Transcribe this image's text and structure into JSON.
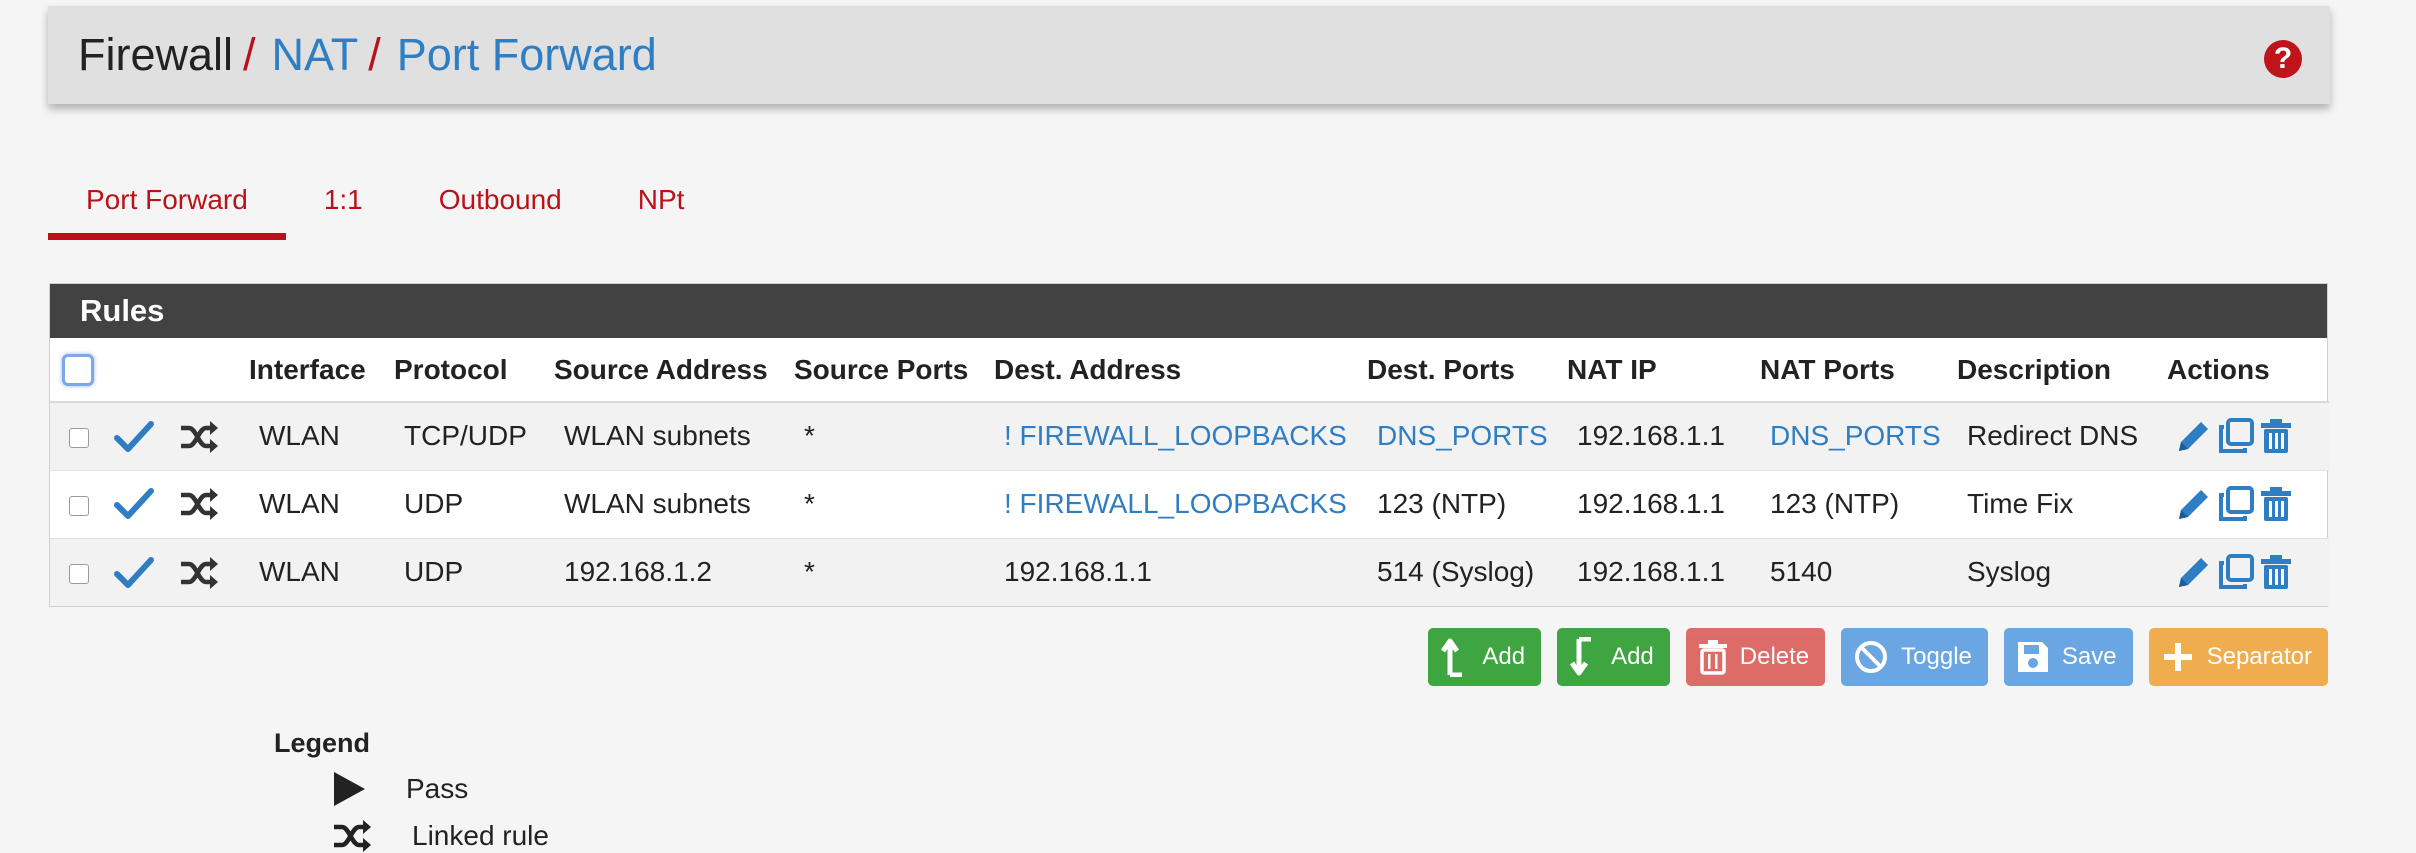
{
  "breadcrumb": {
    "root": "Firewall",
    "sep": "/",
    "nat": "NAT",
    "page": "Port Forward"
  },
  "help_icon": "?",
  "tabs": [
    "Port Forward",
    "1:1",
    "Outbound",
    "NPt"
  ],
  "panel": {
    "title": "Rules",
    "headers": [
      "Interface",
      "Protocol",
      "Source Address",
      "Source Ports",
      "Dest. Address",
      "Dest. Ports",
      "NAT IP",
      "NAT Ports",
      "Description",
      "Actions"
    ],
    "rows": [
      {
        "interface": "WLAN",
        "protocol": "TCP/UDP",
        "src_addr": "WLAN subnets",
        "src_ports": "*",
        "dst_addr": "! FIREWALL_LOOPBACKS",
        "dst_ports": "DNS_PORTS",
        "nat_ip": "192.168.1.1",
        "nat_ports": "DNS_PORTS",
        "description": "Redirect DNS"
      },
      {
        "interface": "WLAN",
        "protocol": "UDP",
        "src_addr": "WLAN subnets",
        "src_ports": "*",
        "dst_addr": "! FIREWALL_LOOPBACKS",
        "dst_ports": "123 (NTP)",
        "nat_ip": "192.168.1.1",
        "nat_ports": "123 (NTP)",
        "description": "Time Fix"
      },
      {
        "interface": "WLAN",
        "protocol": "UDP",
        "src_addr": "192.168.1.2",
        "src_ports": "*",
        "dst_addr": "192.168.1.1",
        "dst_ports": "514 (Syslog)",
        "nat_ip": "192.168.1.1",
        "nat_ports": "5140",
        "description": "Syslog"
      }
    ]
  },
  "buttons": {
    "add_top": "Add",
    "add_bottom": "Add",
    "delete": "Delete",
    "toggle": "Toggle",
    "save": "Save",
    "separator": "Separator"
  },
  "legend": {
    "title": "Legend",
    "items": [
      "Pass",
      "Linked rule"
    ]
  },
  "colors": {
    "accent_red": "#b8131a",
    "link_blue": "#2f7dc2",
    "header_dark": "#424242",
    "btn_green": "#3fa541",
    "btn_red": "#d9534f",
    "btn_blue": "#5a9ee0",
    "btn_orange": "#f0ad4e"
  },
  "icons": {
    "enabled": "check-icon",
    "linked": "shuffle-icon",
    "edit": "pencil-icon",
    "copy": "copy-icon",
    "delete": "trash-icon"
  }
}
